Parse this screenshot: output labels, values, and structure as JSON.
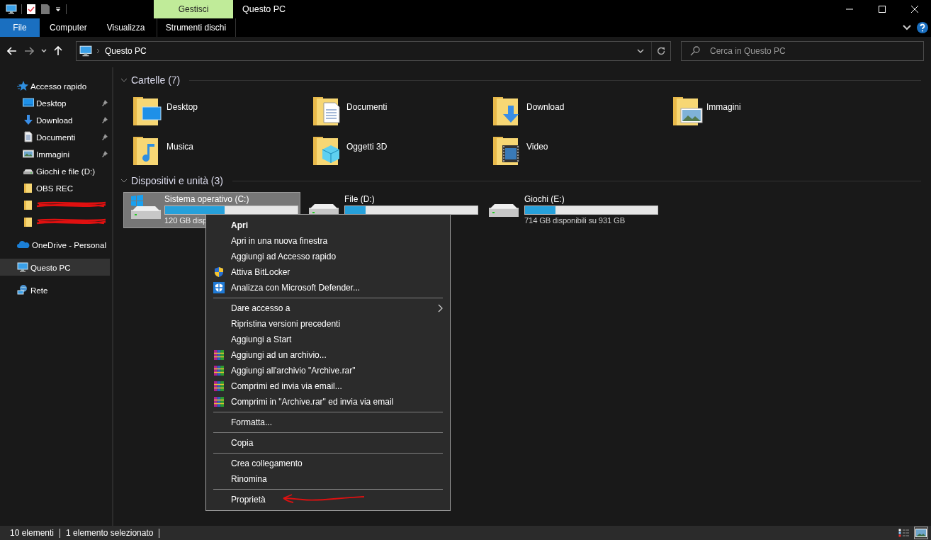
{
  "window": {
    "title": "Questo PC"
  },
  "ribbon": {
    "context_header": "Gestisci",
    "tabs": [
      {
        "label": "File",
        "kind": "file",
        "selected": false
      },
      {
        "label": "Computer",
        "kind": "normal",
        "selected": false
      },
      {
        "label": "Visualizza",
        "kind": "normal",
        "selected": false
      },
      {
        "label": "Strumenti dischi",
        "kind": "contextual",
        "selected": false
      }
    ]
  },
  "address": {
    "path": "Questo PC"
  },
  "search": {
    "placeholder": "Cerca in Questo PC"
  },
  "sidebar": {
    "items": [
      {
        "label": "Accesso rapido",
        "kind": "star",
        "selected": false,
        "children": [
          {
            "label": "Desktop",
            "kind": "desktop",
            "pinned": true,
            "selected": false
          },
          {
            "label": "Download",
            "kind": "download",
            "pinned": true,
            "selected": false
          },
          {
            "label": "Documenti",
            "kind": "document",
            "pinned": true,
            "selected": false
          },
          {
            "label": "Immagini",
            "kind": "pictures",
            "pinned": true,
            "selected": false
          },
          {
            "label": "Giochi e file (D:)",
            "kind": "drive",
            "pinned": false,
            "selected": false
          },
          {
            "label": "OBS REC",
            "kind": "folder",
            "pinned": false,
            "selected": false
          },
          {
            "kind": "folder",
            "redacted": true,
            "pinned": false,
            "selected": false
          },
          {
            "kind": "folder",
            "redacted": true,
            "pinned": false,
            "selected": false
          }
        ]
      },
      {
        "label": "OneDrive - Personal",
        "kind": "cloud",
        "selected": false
      },
      {
        "label": "Questo PC",
        "kind": "computer",
        "selected": true
      },
      {
        "label": "Rete",
        "kind": "network",
        "selected": false
      }
    ]
  },
  "folders": {
    "title": "Cartelle (7)",
    "expanded": true,
    "items": [
      {
        "label": "Desktop",
        "kind": "desktop"
      },
      {
        "label": "Documenti",
        "kind": "document"
      },
      {
        "label": "Download",
        "kind": "download"
      },
      {
        "label": "Immagini",
        "kind": "pictures"
      },
      {
        "label": "Musica",
        "kind": "music"
      },
      {
        "label": "Oggetti 3D",
        "kind": "cube"
      },
      {
        "label": "Video",
        "kind": "video"
      }
    ]
  },
  "drives": {
    "title": "Dispositivi e unità (3)",
    "expanded": true,
    "items": [
      {
        "label": "Sistema operativo (C:)",
        "kind": "system",
        "level": 0.45,
        "free": "120 GB disp",
        "selected": true
      },
      {
        "label": "File (D:)",
        "kind": "disk",
        "level": 0.155,
        "selected": false
      },
      {
        "label": "Giochi (E:)",
        "kind": "disk",
        "level": 0.23,
        "free": "714 GB disponibili su 931 GB",
        "selected": false
      }
    ]
  },
  "context_menu": {
    "items": [
      {
        "kind": "item",
        "label": "Apri",
        "default": true
      },
      {
        "kind": "item",
        "label": "Apri in una nuova finestra"
      },
      {
        "kind": "item",
        "label": "Aggiungi ad Accesso rapido"
      },
      {
        "kind": "bitlocker_item",
        "label": "Attiva BitLocker"
      },
      {
        "kind": "defender_item",
        "label": "Analizza con Microsoft Defender..."
      },
      {
        "kind": "separator"
      },
      {
        "kind": "item",
        "label": "Dare accesso a",
        "submenu": true
      },
      {
        "kind": "item",
        "label": "Ripristina versioni precedenti"
      },
      {
        "kind": "item",
        "label": "Aggiungi a Start"
      },
      {
        "kind": "archive_item",
        "label": "Aggiungi ad un archivio..."
      },
      {
        "kind": "archive_item",
        "label": "Aggiungi all'archivio \"Archive.rar\""
      },
      {
        "kind": "archive_item",
        "label": "Comprimi ed invia via email..."
      },
      {
        "kind": "archive_item",
        "label": "Comprimi in \"Archive.rar\" ed invia via email"
      },
      {
        "kind": "separator"
      },
      {
        "kind": "item",
        "label": "Formatta..."
      },
      {
        "kind": "separator"
      },
      {
        "kind": "item",
        "label": "Copia"
      },
      {
        "kind": "separator"
      },
      {
        "kind": "item",
        "label": "Crea collegamento"
      },
      {
        "kind": "item",
        "label": "Rinomina"
      },
      {
        "kind": "separator"
      },
      {
        "kind": "item",
        "label": "Proprietà",
        "annotated": true
      }
    ]
  },
  "status_bar": {
    "count": "10 elementi",
    "selection": "1 elemento selezionato",
    "views": [
      {
        "kind": "details",
        "selected": false
      },
      {
        "kind": "large_icons",
        "selected": true
      }
    ]
  }
}
